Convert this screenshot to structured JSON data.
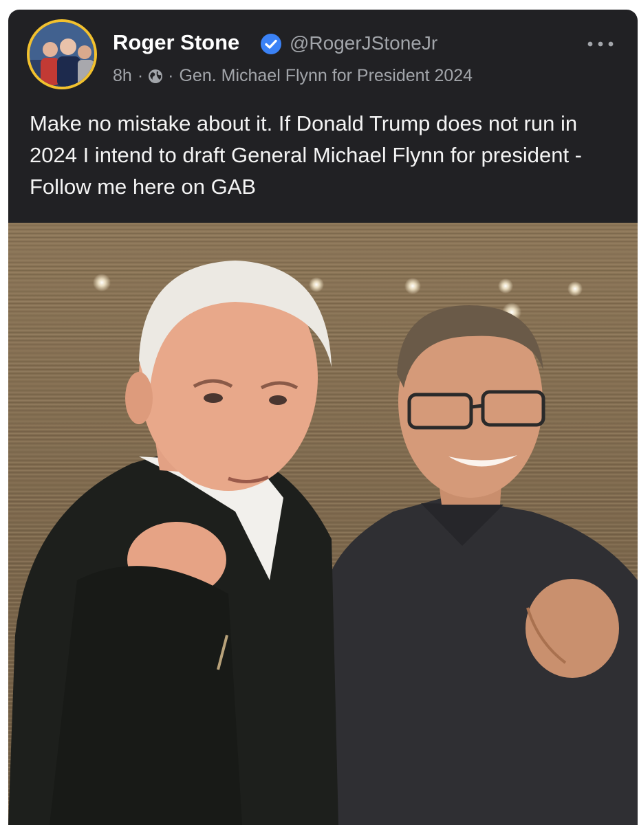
{
  "post": {
    "author_name": "Roger Stone",
    "handle": "@RogerJStoneJr",
    "time": "8h",
    "separator": "·",
    "group": "Gen. Michael Flynn for President 2024",
    "text": "Make no mistake about it. If Donald Trump does not run in 2024 I intend to draft General Michael Flynn for president - Follow me here on GAB"
  },
  "icons": {
    "verified": "verified-badge-icon",
    "visibility": "globe-icon",
    "menu": "more-options-icon"
  },
  "colors": {
    "card_background": "#212124",
    "avatar_ring": "#f2c12e",
    "verified_badge": "#3b82f6",
    "secondary_text": "#a2a5aa",
    "primary_text": "#f4f4f4"
  }
}
